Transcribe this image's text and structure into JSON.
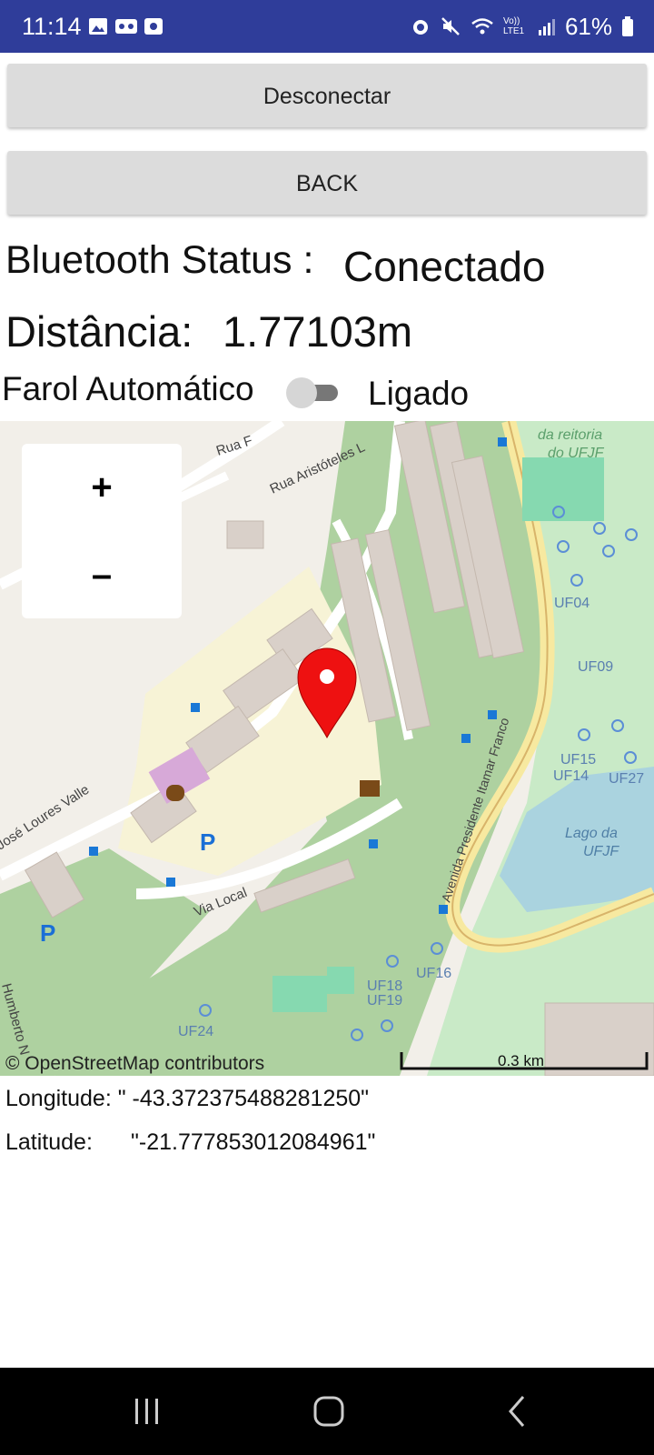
{
  "status_bar": {
    "time": "11:14",
    "network_label": "Vo)) LTE1",
    "battery_percent": "61%",
    "icons": [
      "image-icon",
      "voicemail-icon",
      "screen-record-icon",
      "alarm-icon",
      "mute-icon",
      "wifi-icon",
      "signal-icon",
      "battery-icon"
    ]
  },
  "buttons": {
    "disconnect": "Desconectar",
    "back": "BACK"
  },
  "bluetooth": {
    "label": "Bluetooth Status :",
    "value": "Conectado"
  },
  "distance": {
    "label": "Distância:",
    "value": "1.77103m"
  },
  "farol": {
    "label": "Farol Automático",
    "value": "Ligado",
    "switch_on": false
  },
  "map": {
    "zoom_in": "+",
    "zoom_out": "–",
    "attribution": "© OpenStreetMap contributors",
    "scale": "0.3 km",
    "labels": {
      "reitoria_1": "da reitoria",
      "reitoria_2": "do UFJF",
      "rua_f": "Rua F",
      "rua_aristoteles": "Rua Aristóteles L",
      "avenida": "Avenida Presidente Itamar Franco",
      "jose_loures": "José Loures Valle",
      "via_local": "Via Local",
      "lago_1": "Lago da",
      "lago_2": "UFJF",
      "uf04": "UF04",
      "uf09": "UF09",
      "uf15": "UF15",
      "uf14": "UF14",
      "uf27": "UF27",
      "uf16": "UF16",
      "uf18": "UF18",
      "uf19": "UF19",
      "uf24": "UF24",
      "humberto": "Humberto N",
      "parking": "P"
    },
    "colors": {
      "green": "#aed1a0",
      "light_green": "#c9eac7",
      "building": "#d9d0c9",
      "water": "#aad3df",
      "marker": "#ee1111"
    }
  },
  "coordinates": {
    "longitude_row": "Longitude: \" -43.372375488281250\"",
    "latitude_label": "Latitude:",
    "latitude_value": "\"-21.777853012084961\""
  },
  "nav_bar": {
    "icons": [
      "recents-icon",
      "home-icon",
      "back-icon"
    ]
  }
}
